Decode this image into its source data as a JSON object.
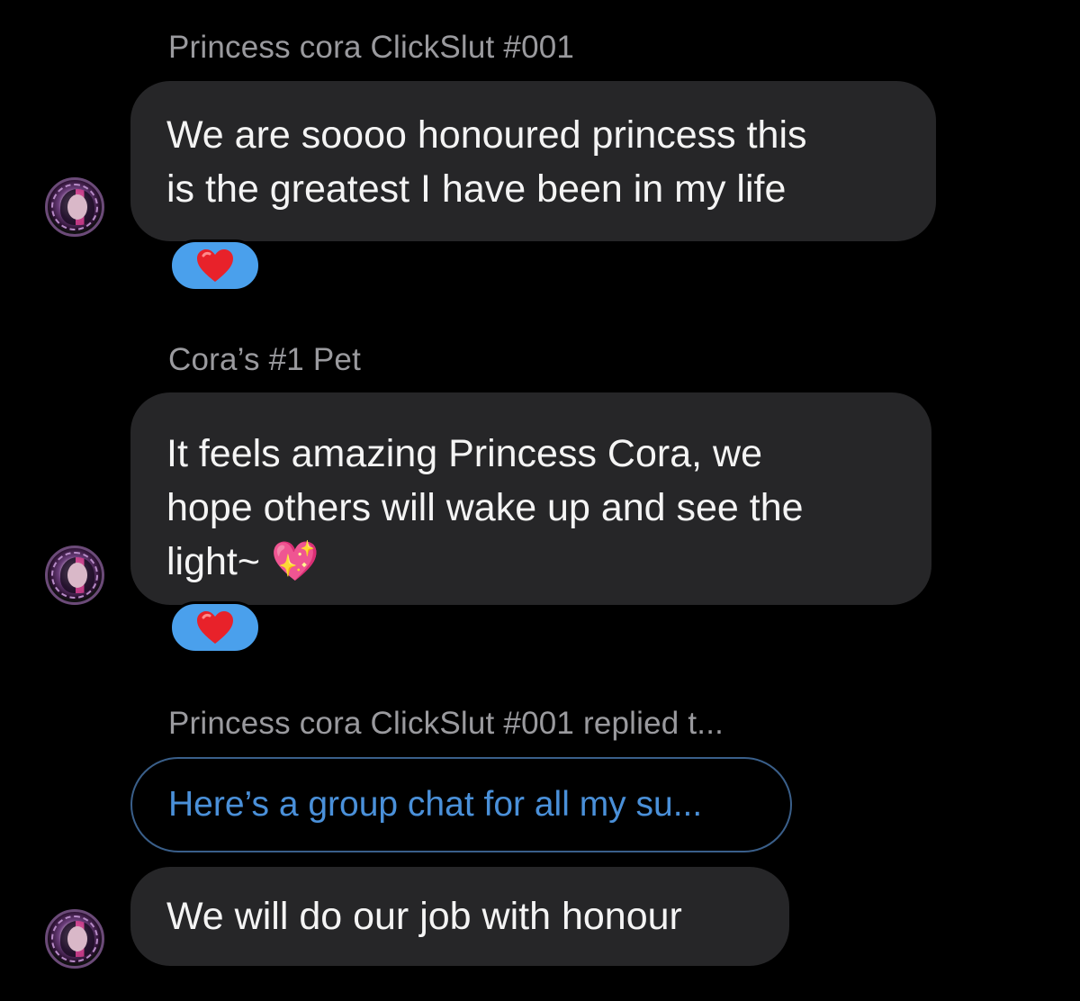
{
  "messages": [
    {
      "sender": "Princess cora ClickSlut #001",
      "lines": [
        "We are soooo honoured princess this",
        "is the greatest I have been in my life"
      ],
      "reaction": "❤️"
    },
    {
      "sender": "Cora’s #1 Pet",
      "lines": [
        "It feels amazing Princess Cora, we",
        "hope others will wake up and see the",
        "light~ 💖"
      ],
      "reaction": "❤️"
    },
    {
      "sender": "Princess cora ClickSlut #001 replied t...",
      "quoted_reply": "Here’s a group chat for all my su...",
      "lines": [
        "We will do our job with honour"
      ]
    }
  ],
  "avatar_icon": "avatar-icon"
}
